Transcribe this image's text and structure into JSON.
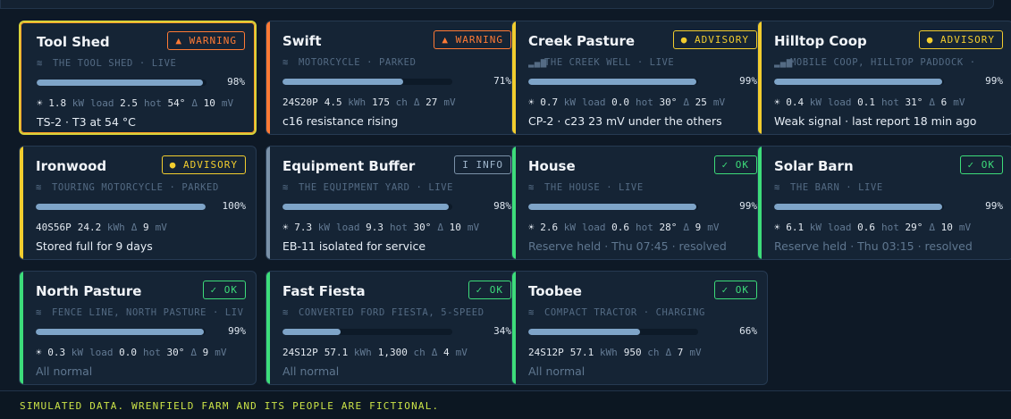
{
  "footer": "SIMULATED DATA. WRENFIELD FARM AND ITS PEOPLE ARE FICTIONAL.",
  "colors": {
    "warning": "#ff7a35",
    "advisory": "#f2cd2e",
    "info": "#7a91a8",
    "ok": "#3ddc7a"
  },
  "cards": [
    {
      "title": "Tool Shed",
      "badge": "▲ WARNING",
      "level": "warning",
      "location": "THE TOOL SHED · LIVE",
      "signal": "wifi-icon",
      "charge_pct": 98,
      "charge_text": "98%",
      "stats": [
        {
          "v": "☀ 1.8",
          "u": "kW"
        },
        {
          "u": "load",
          "v": "2.5"
        },
        {
          "u": "hot",
          "v": "54°"
        },
        {
          "u": "Δ",
          "v": "10"
        },
        {
          "u": "mV"
        }
      ],
      "note": "TS-2 · T3 at 54 °C",
      "resolved": false,
      "highlight": true
    },
    {
      "title": "Swift",
      "badge": "▲ WARNING",
      "level": "warning",
      "location": "MOTORCYCLE · PARKED",
      "signal": "wifi-icon",
      "charge_pct": 71,
      "charge_text": "71%",
      "stats": [
        {
          "v": "24S20P"
        },
        {
          "v": "4.5",
          "u": "kWh"
        },
        {
          "v": "175",
          "u": "ch"
        },
        {
          "u": "Δ",
          "v": "27"
        },
        {
          "u": "mV"
        }
      ],
      "note": "c16 resistance rising",
      "resolved": false
    },
    {
      "title": "Creek Pasture",
      "badge": "● ADVISORY",
      "level": "advisory",
      "location": "THE CREEK WELL · LIVE",
      "signal": "signal-bars-icon",
      "charge_pct": 99,
      "charge_text": "99%",
      "stats": [
        {
          "v": "☀ 0.7",
          "u": "kW"
        },
        {
          "u": "load",
          "v": "0.0"
        },
        {
          "u": "hot",
          "v": "30°"
        },
        {
          "u": "Δ",
          "v": "25"
        },
        {
          "u": "mV"
        }
      ],
      "note": "CP-2 · c23 23 mV under the others",
      "resolved": false
    },
    {
      "title": "Hilltop Coop",
      "badge": "● ADVISORY",
      "level": "advisory",
      "location": "MOBILE COOP, HILLTOP PADDOCK ·",
      "signal": "signal-bars-icon",
      "charge_pct": 99,
      "charge_text": "99%",
      "stats": [
        {
          "v": "☀ 0.4",
          "u": "kW"
        },
        {
          "u": "load",
          "v": "0.1"
        },
        {
          "u": "hot",
          "v": "31°"
        },
        {
          "u": "Δ",
          "v": "6"
        },
        {
          "u": "mV"
        }
      ],
      "note": "Weak signal · last report 18 min ago",
      "resolved": false
    },
    {
      "title": "Ironwood",
      "badge": "● ADVISORY",
      "level": "advisory",
      "location": "TOURING MOTORCYCLE · PARKED",
      "signal": "wifi-icon",
      "charge_pct": 100,
      "charge_text": "100%",
      "stats": [
        {
          "v": "40S56P"
        },
        {
          "v": "24.2",
          "u": "kWh"
        },
        {
          "u": "Δ",
          "v": "9"
        },
        {
          "u": "mV"
        }
      ],
      "note": "Stored full for 9 days",
      "resolved": false
    },
    {
      "title": "Equipment Buffer",
      "badge": "I INFO",
      "level": "info",
      "location": "THE EQUIPMENT YARD · LIVE",
      "signal": "wifi-icon",
      "charge_pct": 98,
      "charge_text": "98%",
      "stats": [
        {
          "v": "☀ 7.3",
          "u": "kW"
        },
        {
          "u": "load",
          "v": "9.3"
        },
        {
          "u": "hot",
          "v": "30°"
        },
        {
          "u": "Δ",
          "v": "10"
        },
        {
          "u": "mV"
        }
      ],
      "note": "EB-11 isolated for service",
      "resolved": false
    },
    {
      "title": "House",
      "badge": "✓ OK",
      "level": "ok",
      "location": "THE HOUSE · LIVE",
      "signal": "wifi-icon",
      "charge_pct": 99,
      "charge_text": "99%",
      "stats": [
        {
          "v": "☀ 2.6",
          "u": "kW"
        },
        {
          "u": "load",
          "v": "0.6"
        },
        {
          "u": "hot",
          "v": "28°"
        },
        {
          "u": "Δ",
          "v": "9"
        },
        {
          "u": "mV"
        }
      ],
      "note": "Reserve held · Thu 07:45 · resolved",
      "resolved": true
    },
    {
      "title": "Solar Barn",
      "badge": "✓ OK",
      "level": "ok",
      "location": "THE BARN · LIVE",
      "signal": "wifi-icon",
      "charge_pct": 99,
      "charge_text": "99%",
      "stats": [
        {
          "v": "☀ 6.1",
          "u": "kW"
        },
        {
          "u": "load",
          "v": "0.6"
        },
        {
          "u": "hot",
          "v": "29°"
        },
        {
          "u": "Δ",
          "v": "10"
        },
        {
          "u": "mV"
        }
      ],
      "note": "Reserve held · Thu 03:15 · resolved",
      "resolved": true
    },
    {
      "title": "North Pasture",
      "badge": "✓ OK",
      "level": "ok",
      "location": "FENCE LINE, NORTH PASTURE · LIV",
      "signal": "wifi-icon",
      "charge_pct": 99,
      "charge_text": "99%",
      "stats": [
        {
          "v": "☀ 0.3",
          "u": "kW"
        },
        {
          "u": "load",
          "v": "0.0"
        },
        {
          "u": "hot",
          "v": "30°"
        },
        {
          "u": "Δ",
          "v": "9"
        },
        {
          "u": "mV"
        }
      ],
      "note": "All normal",
      "resolved": true
    },
    {
      "title": "Fast Fiesta",
      "badge": "✓ OK",
      "level": "ok",
      "location": "CONVERTED FORD FIESTA, 5-SPEED",
      "signal": "wifi-icon",
      "charge_pct": 34,
      "charge_text": "34%",
      "stats": [
        {
          "v": "24S12P"
        },
        {
          "v": "57.1",
          "u": "kWh"
        },
        {
          "v": "1,300",
          "u": "ch"
        },
        {
          "u": "Δ",
          "v": "4"
        },
        {
          "u": "mV"
        }
      ],
      "note": "All normal",
      "resolved": true
    },
    {
      "title": "Toobee",
      "badge": "✓ OK",
      "level": "ok",
      "location": "COMPACT TRACTOR · CHARGING",
      "signal": "wifi-icon",
      "charge_pct": 66,
      "charge_text": "66%",
      "stats": [
        {
          "v": "24S12P"
        },
        {
          "v": "57.1",
          "u": "kWh"
        },
        {
          "v": "950",
          "u": "ch"
        },
        {
          "u": "Δ",
          "v": "7"
        },
        {
          "u": "mV"
        }
      ],
      "note": "All normal",
      "resolved": true
    }
  ]
}
